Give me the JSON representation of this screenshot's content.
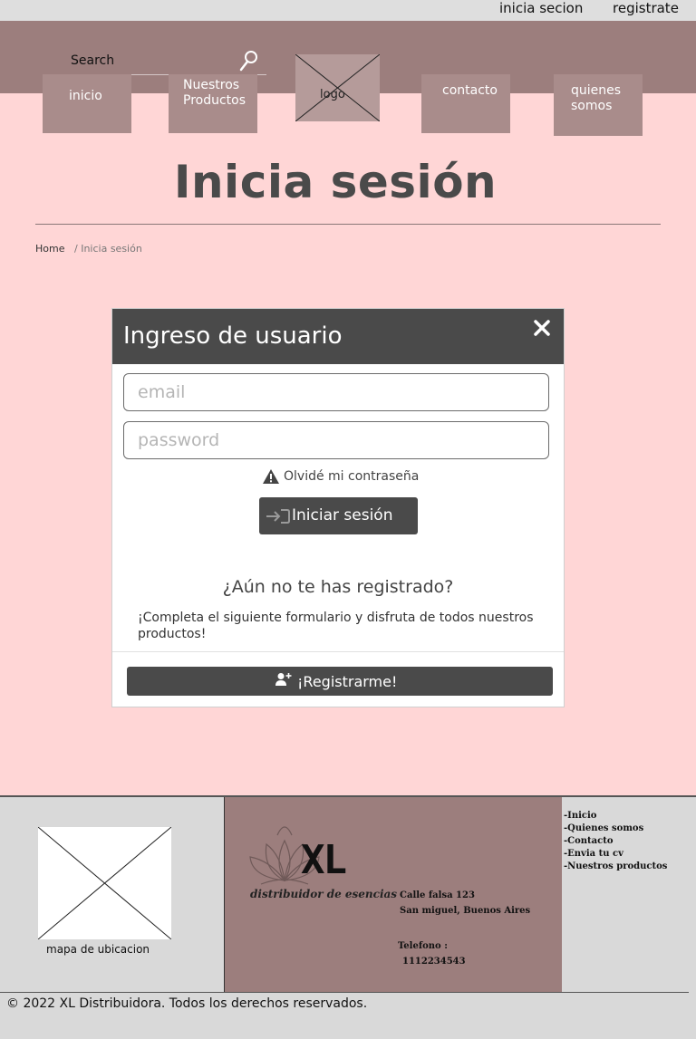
{
  "topbar": {
    "login_label": "inicia secion",
    "register_label": "registrate"
  },
  "header": {
    "search_label": "Search",
    "search_icon": "magnifier-icon",
    "nav": {
      "inicio": "inicio",
      "productos": "Nuestros Productos",
      "logo": "logo",
      "contacto": "contacto",
      "quienes": "quienes somos"
    }
  },
  "page": {
    "title": "Inicia sesión",
    "breadcrumb": {
      "home": "Home",
      "separator": "/",
      "current": "Inicia sesión"
    }
  },
  "modal": {
    "title": "Ingreso de usuario",
    "email_placeholder": "email",
    "password_placeholder": "password",
    "forgot_label": "Olvidé mi contraseña",
    "login_button": "Iniciar sesión",
    "register_question": "¿Aún no te has registrado?",
    "register_text": "¡Completa el siguiente formulario y disfruta de todos nuestros productos!",
    "register_button": "¡Registrarme!"
  },
  "footer": {
    "map_caption": "mapa de ubicacion",
    "brand": {
      "name": "XL",
      "tagline": "distribuidor de esencias"
    },
    "address_line1": "Calle falsa 123",
    "address_line2": "San miguel, Buenos Aires",
    "phone_label": "Telefono :",
    "phone": "1112234543",
    "links": [
      "-Inicio",
      "-Quienes somos",
      "-Contacto",
      "-Envia tu cv",
      "-Nuestros productos"
    ],
    "copyright": "© 2022 XL Distribuidora. Todos los derechos reservados."
  },
  "colors": {
    "background": "#ffd6d6",
    "header": "#9c7e7d",
    "nav_button": "#a98c8b",
    "modal_header": "#4a4a4a",
    "footer": "#d9d9d9"
  }
}
